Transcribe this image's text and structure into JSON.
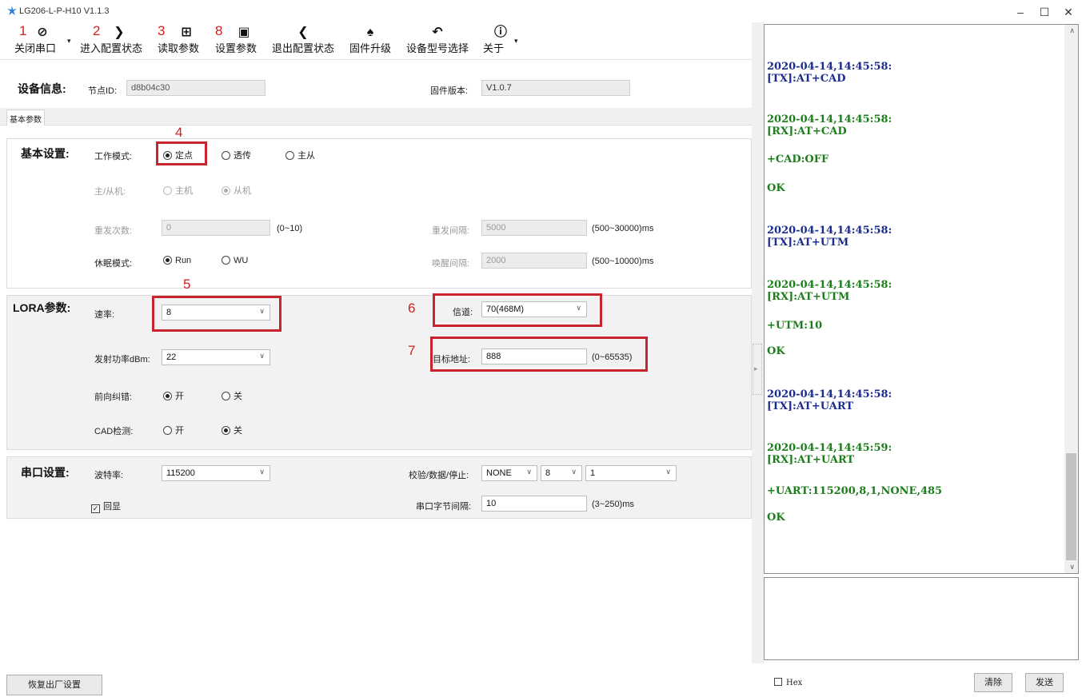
{
  "window": {
    "title": "LG206-L-P-H10 V1.1.3",
    "controls": {
      "minimize": "–",
      "maximize": "☐",
      "close": "✕"
    }
  },
  "toolbar": {
    "items": [
      {
        "label": "关闭串口",
        "icon": "⊘",
        "icon_name": "disconnect-icon",
        "step": "1"
      },
      {
        "label": "进入配置状态",
        "icon": "❯",
        "icon_name": "chevron-right-icon",
        "step": "2"
      },
      {
        "label": "读取参数",
        "icon": "⊞",
        "icon_name": "read-document-icon",
        "step": "3"
      },
      {
        "label": "设置参数",
        "icon": "▣",
        "icon_name": "save-icon",
        "step": "8"
      },
      {
        "label": "退出配置状态",
        "icon": "❮",
        "icon_name": "chevron-left-icon",
        "step": ""
      },
      {
        "label": "固件升级",
        "icon": "♠",
        "icon_name": "rocket-icon",
        "step": ""
      },
      {
        "label": "设备型号选择",
        "icon": "↶",
        "icon_name": "reply-arrow-icon",
        "step": ""
      },
      {
        "label": "关于",
        "icon": "ⓘ",
        "icon_name": "info-icon",
        "step": ""
      }
    ],
    "dropdown_caret": "▾"
  },
  "device_info": {
    "title": "设备信息:",
    "node_id_label": "节点ID:",
    "node_id_value": "d8b04c30",
    "fw_label": "固件版本:",
    "fw_value": "V1.0.7"
  },
  "tab": {
    "label": "基本参数"
  },
  "basic": {
    "title": "基本设置:",
    "step": "4",
    "work_mode_label": "工作模式:",
    "work_modes": [
      {
        "label": "定点",
        "selected": true
      },
      {
        "label": "透传",
        "selected": false
      },
      {
        "label": "主从",
        "selected": false
      }
    ],
    "master_slave_label": "主/从机:",
    "master_slave": [
      {
        "label": "主机",
        "selected": false
      },
      {
        "label": "从机",
        "selected": true
      }
    ],
    "retry_count_label": "重发次数:",
    "retry_count_value": "0",
    "retry_count_range": "(0~10)",
    "retry_interval_label": "重发间隔:",
    "retry_interval_value": "5000",
    "retry_interval_range": "(500~30000)ms",
    "sleep_mode_label": "休眠模式:",
    "sleep_modes": [
      {
        "label": "Run",
        "selected": true
      },
      {
        "label": "WU",
        "selected": false
      }
    ],
    "wake_interval_label": "唤醒间隔:",
    "wake_interval_value": "2000",
    "wake_interval_range": "(500~10000)ms"
  },
  "lora": {
    "title": "LORA参数:",
    "rate_step": "5",
    "rate_label": "速率:",
    "rate_value": "8",
    "channel_step": "6",
    "channel_label": "信道:",
    "channel_value": "70(468M)",
    "power_label": "发射功率dBm:",
    "power_value": "22",
    "addr_step": "7",
    "addr_label": "目标地址:",
    "addr_value": "888",
    "addr_range": "(0~65535)",
    "fec_label": "前向纠错:",
    "fec": [
      {
        "label": "开",
        "selected": true
      },
      {
        "label": "关",
        "selected": false
      }
    ],
    "cad_label": "CAD检测:",
    "cad": [
      {
        "label": "开",
        "selected": false
      },
      {
        "label": "关",
        "selected": true
      }
    ]
  },
  "serial": {
    "title": "串口设置:",
    "baud_label": "波特率:",
    "baud_value": "115200",
    "parity_label": "校验/数据/停止:",
    "parity_value": "NONE",
    "data_bits_value": "8",
    "stop_bits_value": "1",
    "echo_label": "回显",
    "echo_checked": true,
    "byte_interval_label": "串口字节间隔:",
    "byte_interval_value": "10",
    "byte_interval_range": "(3~250)ms"
  },
  "factory_reset_label": "恢复出厂设置",
  "log": {
    "entries": [
      {
        "text": "2020-04-14,14:45:58:",
        "color": "#1c2c8c"
      },
      {
        "text": "[TX]:AT+CAD",
        "color": "#1c2c8c"
      },
      {
        "text": "2020-04-14,14:45:58:",
        "color": "#1d7d1d"
      },
      {
        "text": "[RX]:AT+CAD",
        "color": "#1d7d1d"
      },
      {
        "text": "+CAD:OFF",
        "color": "#1d7d1d"
      },
      {
        "text": "OK",
        "color": "#1d7d1d"
      },
      {
        "text": "2020-04-14,14:45:58:",
        "color": "#1c2c8c"
      },
      {
        "text": "[TX]:AT+UTM",
        "color": "#1c2c8c"
      },
      {
        "text": "2020-04-14,14:45:58:",
        "color": "#1d7d1d"
      },
      {
        "text": "[RX]:AT+UTM",
        "color": "#1d7d1d"
      },
      {
        "text": "+UTM:10",
        "color": "#1d7d1d"
      },
      {
        "text": "OK",
        "color": "#1d7d1d"
      },
      {
        "text": "2020-04-14,14:45:58:",
        "color": "#1c2c8c"
      },
      {
        "text": "[TX]:AT+UART",
        "color": "#1c2c8c"
      },
      {
        "text": "2020-04-14,14:45:59:",
        "color": "#1d7d1d"
      },
      {
        "text": "[RX]:AT+UART",
        "color": "#1d7d1d"
      },
      {
        "text": "+UART:115200,8,1,NONE,485",
        "color": "#1d7d1d"
      },
      {
        "text": "OK",
        "color": "#1d7d1d"
      }
    ]
  },
  "hex_label": "Hex",
  "clear_label": "清除",
  "send_label": "发送",
  "colors": {
    "highlight_box": "#c8242f",
    "step_number": "#d21f1f",
    "tx": "#1c2c8c",
    "rx": "#1d7d1d"
  }
}
